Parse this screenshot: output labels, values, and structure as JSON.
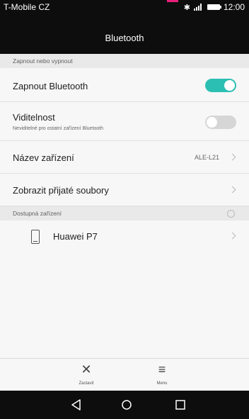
{
  "status_bar": {
    "carrier": "T-Mobile CZ",
    "time": "12:00",
    "notification_color": "#e8207a"
  },
  "title_bar": {
    "title": "Bluetooth"
  },
  "sections": {
    "toggle_section": "Zapnout nebo vypnout",
    "devices_section": "Dostupná zařízení"
  },
  "settings": {
    "bluetooth": {
      "label": "Zapnout Bluetooth",
      "on": true
    },
    "visibility": {
      "label": "Viditelnost",
      "subtitle": "Neviditelné pro ostatní zařízení Bluetooth",
      "on": false
    },
    "device_name": {
      "label": "Název zařízení",
      "value": "ALE-L21"
    },
    "received_files": {
      "label": "Zobrazit přijaté soubory"
    }
  },
  "devices": [
    {
      "name": "Huawei P7",
      "icon": "phone-icon"
    }
  ],
  "toolbar": {
    "stop_label": "Zastavit",
    "menu_label": "Menu"
  },
  "navigation": {
    "icons": [
      "back-icon",
      "home-icon",
      "recents-icon"
    ]
  },
  "colors": {
    "accent": "#2bbfb3",
    "toggle_off": "#d6d6d6",
    "bar_background": "#0d0d0d"
  }
}
